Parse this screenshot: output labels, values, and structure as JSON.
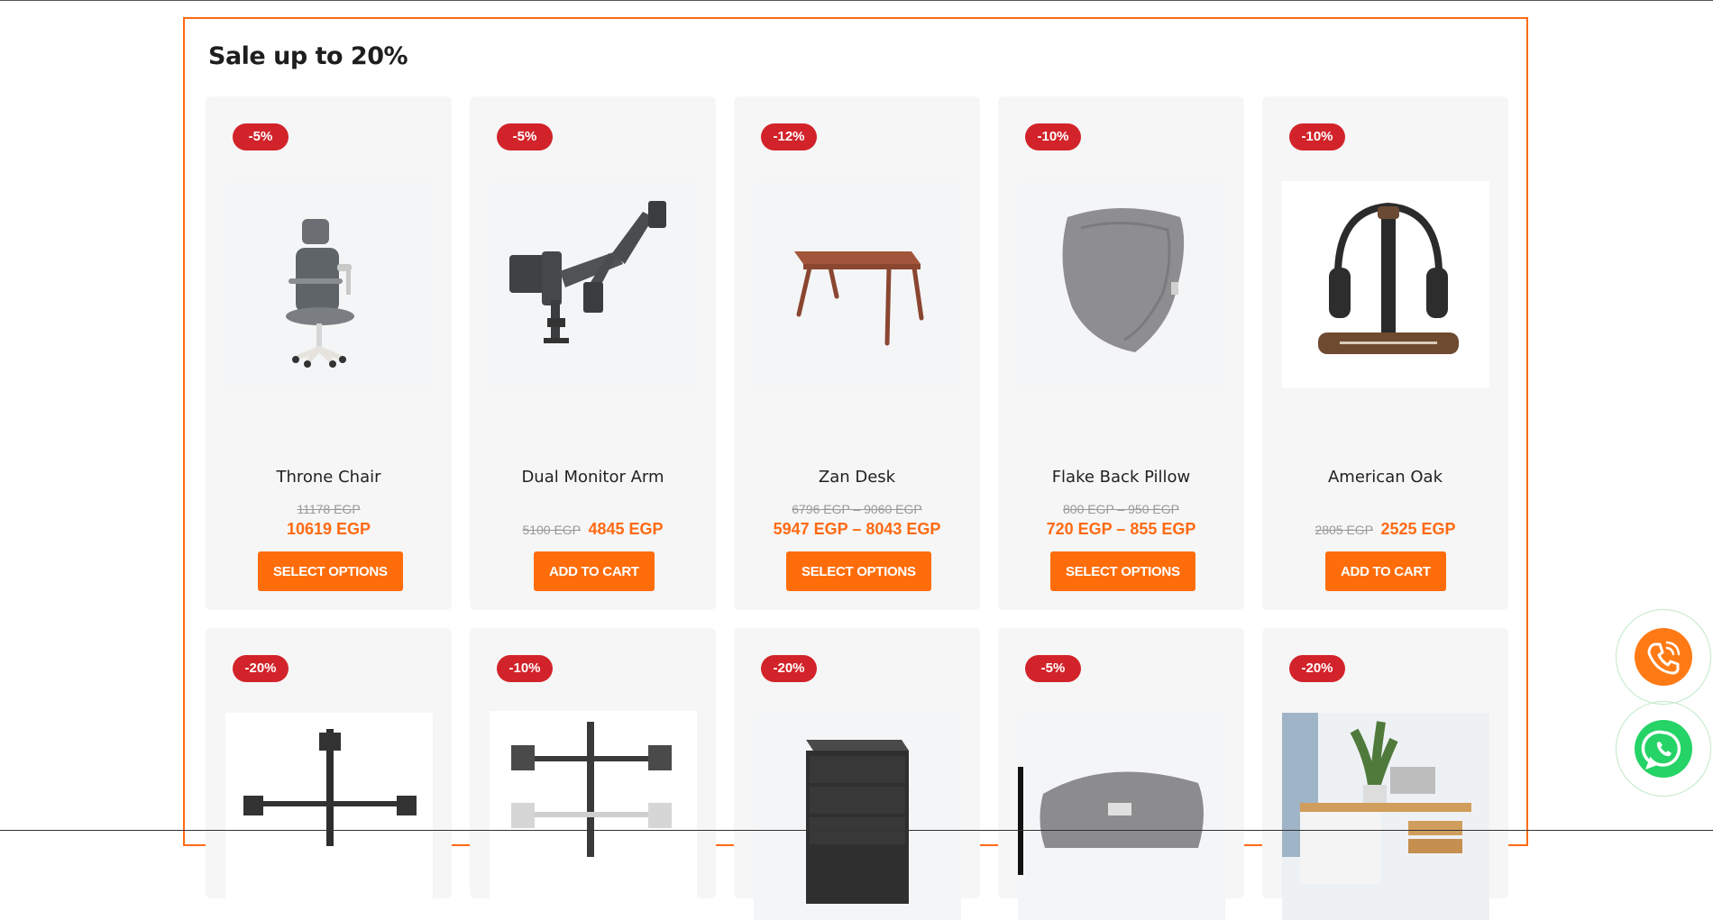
{
  "section": {
    "title": "Sale up to 20%"
  },
  "colors": {
    "accent": "#ff6a13",
    "badge": "#d2232a",
    "card": "#f6f6f6",
    "whatsapp": "#25d366"
  },
  "products": [
    {
      "name": "Throne Chair",
      "badge": "-5%",
      "old_price": "11178 EGP",
      "new_price": "10619 EGP",
      "button": "SELECT OPTIONS",
      "icon": "chair-image"
    },
    {
      "name": "Dual Monitor Arm",
      "badge": "-5%",
      "old_price": "5100 EGP",
      "new_price": "4845 EGP",
      "button": "ADD TO CART",
      "icon": "monitor-arm-image"
    },
    {
      "name": "Zan Desk",
      "badge": "-12%",
      "old_price": "6796 EGP – 9060 EGP",
      "new_price": "5947 EGP – 8043 EGP",
      "button": "SELECT OPTIONS",
      "icon": "desk-image"
    },
    {
      "name": "Flake Back Pillow",
      "badge": "-10%",
      "old_price": "800 EGP – 950 EGP",
      "new_price": "720 EGP – 855 EGP",
      "button": "SELECT OPTIONS",
      "icon": "pillow-image"
    },
    {
      "name": "American Oak",
      "badge": "-10%",
      "old_price": "2805 EGP",
      "new_price": "2525 EGP",
      "button": "ADD TO CART",
      "icon": "headphone-stand-image"
    }
  ],
  "products_row2": [
    {
      "badge": "-20%",
      "icon": "triple-monitor-stand-image"
    },
    {
      "badge": "-10%",
      "icon": "quad-monitor-stand-image"
    },
    {
      "badge": "-20%",
      "icon": "drawer-cabinet-image"
    },
    {
      "badge": "-5%",
      "icon": "seat-cushion-image"
    },
    {
      "badge": "-20%",
      "icon": "office-desk-image"
    }
  ],
  "floating": {
    "call_icon": "phone-call-icon",
    "whatsapp_icon": "whatsapp-icon"
  }
}
